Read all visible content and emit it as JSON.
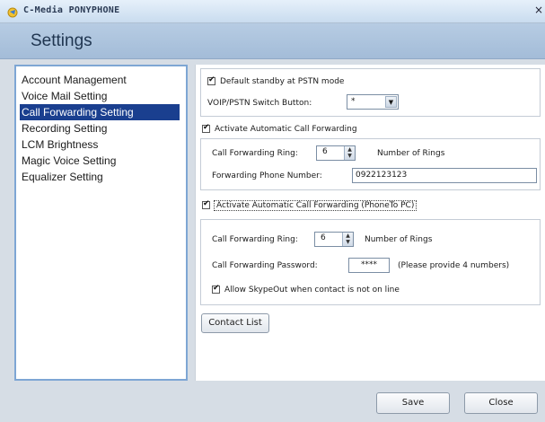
{
  "window": {
    "title": "C-Media PONYPHONE",
    "close_glyph": "×"
  },
  "header": {
    "title": "Settings"
  },
  "sidebar": {
    "items": [
      {
        "label": "Account Management"
      },
      {
        "label": "Voice Mail Setting"
      },
      {
        "label": "Call Forwarding Setting",
        "selected": true
      },
      {
        "label": "Recording Setting"
      },
      {
        "label": "LCM Brightness"
      },
      {
        "label": "Magic Voice Setting"
      },
      {
        "label": "Equalizer Setting"
      }
    ]
  },
  "standby": {
    "checkbox_label": "Default standby at PSTN mode",
    "checked": true,
    "switch_label": "VOIP/PSTN Switch Button:",
    "switch_value": "*"
  },
  "forward": {
    "checkbox_label": "Activate Automatic Call Forwarding",
    "checked": true,
    "ring_label": "Call Forwarding Ring:",
    "ring_value": "6",
    "rings_unit": "Number of Rings",
    "phone_label": "Forwarding Phone Number:",
    "phone_value": "0922123123"
  },
  "forward_pc": {
    "checkbox_label": "Activate Automatic Call Forwarding (PhoneTo PC)",
    "checked": true,
    "ring_label": "Call Forwarding Ring:",
    "ring_value": "6",
    "rings_unit": "Number of Rings",
    "password_label": "Call Forwarding Password:",
    "password_value": "****",
    "password_hint": "(Please provide 4 numbers)",
    "skypeout_label": "Allow SkypeOut when contact is not on line",
    "skypeout_checked": true
  },
  "buttons": {
    "contact_list": "Contact List",
    "save": "Save",
    "close": "Close"
  },
  "glyphs": {
    "check": "✔",
    "down": "▼",
    "up": "▲"
  },
  "colors": {
    "selection": "#1a3f8f",
    "header": "#a3bcd8",
    "sidebar_border": "#7ea6d4"
  }
}
